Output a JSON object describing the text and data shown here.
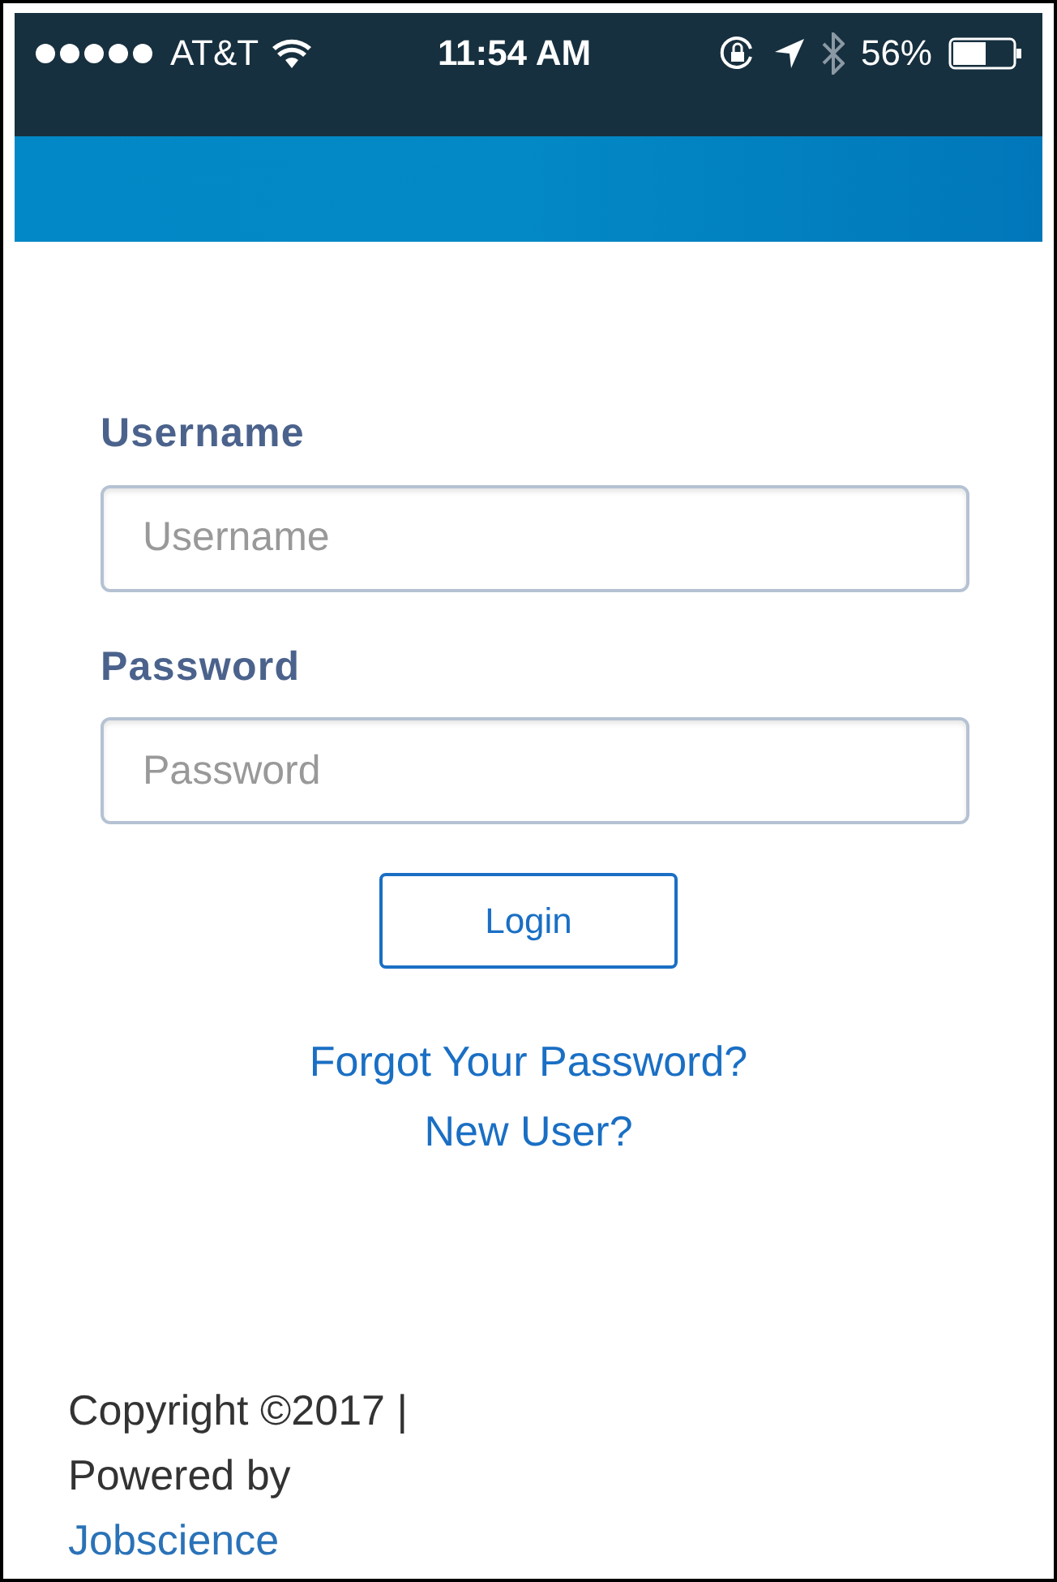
{
  "status_bar": {
    "carrier": "AT&T",
    "time": "11:54 AM",
    "battery": "56%"
  },
  "form": {
    "fields": [
      {
        "label": "Username",
        "placeholder": "Username"
      },
      {
        "label": "Password",
        "placeholder": "Password"
      }
    ],
    "login_button": "Login",
    "links": [
      "Forgot Your Password?",
      "New User?"
    ]
  },
  "footer": {
    "copyright": "Copyright ©2017 |",
    "powered_by": "Powered by",
    "link": "Jobscience"
  }
}
